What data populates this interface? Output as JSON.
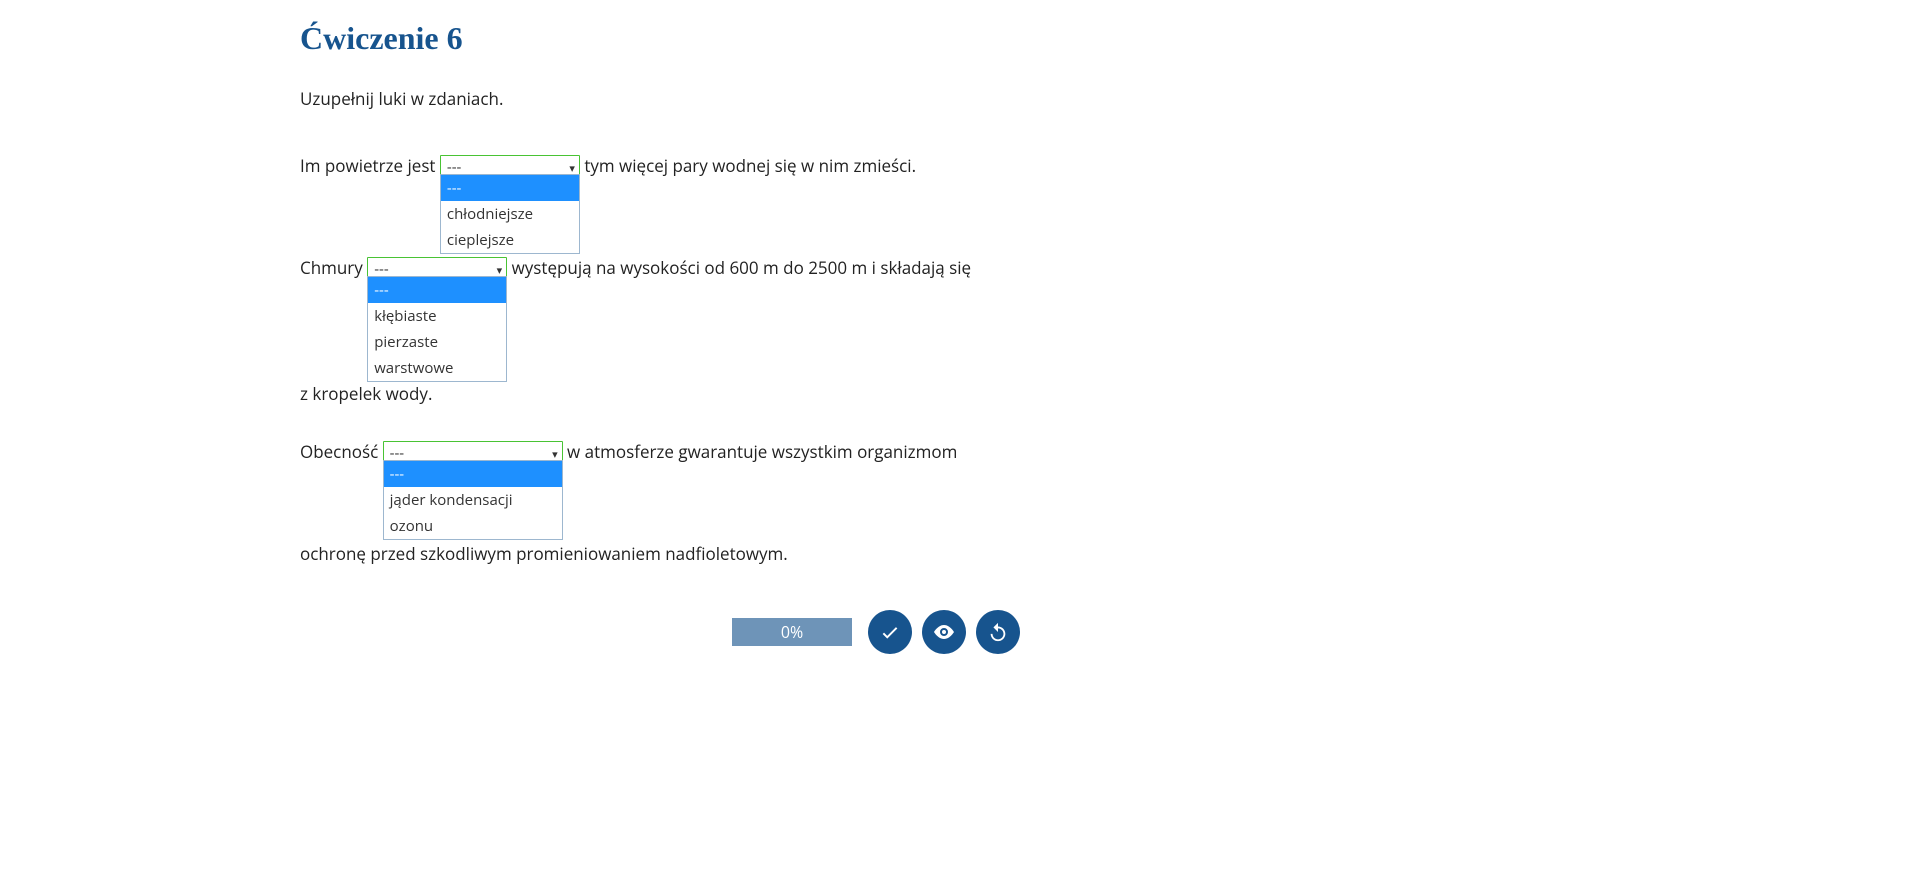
{
  "title": "Ćwiczenie 6",
  "instruction": "Uzupełnij luki w zdaniach.",
  "text": {
    "s1_before": "Im powietrze jest ",
    "s1_after": " tym więcej pary wodnej się w nim zmieści.",
    "s2_before": "Chmury ",
    "s2_after": " występują na wysokości od 600 m do 2500 m i składają się",
    "s2_cont": "z kropelek wody.",
    "s3_before": "Obecność ",
    "s3_after": " w atmosferze gwarantuje wszystkim organizmom",
    "s3_cont": "ochronę przed szkodliwym promieniowaniem nadfioletowym."
  },
  "selects": {
    "s1": {
      "value": "---",
      "options": [
        "---",
        "chłodniejsze",
        "cieplejsze"
      ]
    },
    "s2": {
      "value": "---",
      "options": [
        "---",
        "kłębiaste",
        "pierzaste",
        "warstwowe"
      ]
    },
    "s3": {
      "value": "---",
      "options": [
        "---",
        "jąder kondensacji",
        "ozonu"
      ]
    }
  },
  "footer": {
    "progress": "0%"
  }
}
